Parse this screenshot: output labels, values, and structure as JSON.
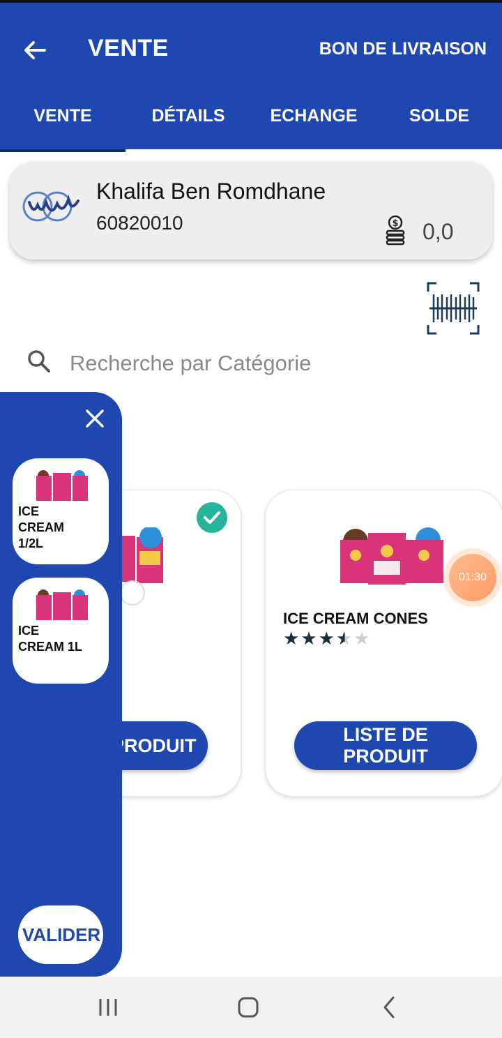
{
  "header": {
    "title": "VENTE",
    "action_label": "BON DE LIVRAISON",
    "tabs": [
      "VENTE",
      "DÉTAILS",
      "ECHANGE",
      "SOLDE"
    ],
    "active_tab": 0,
    "color": "#1f47b0"
  },
  "client": {
    "name": "Khalifa Ben Romdhane",
    "phone": "60820010",
    "balance": "0,0",
    "logo_icon": "company-logo",
    "balance_icon": "coins-dollar-icon"
  },
  "search": {
    "placeholder": "Recherche par Catégorie"
  },
  "products": [
    {
      "button_label": "PRODUIT",
      "selected": true
    },
    {
      "name": "ICE CREAM CONES",
      "rating": 3.5,
      "rating_max": 5,
      "button_label": "LISTE DE PRODUIT",
      "timer": "01:30"
    }
  ],
  "drawer": {
    "categories": [
      {
        "label": "ICE CREAM 1/2L"
      },
      {
        "label": "ICE CREAM 1L"
      }
    ],
    "validate_label": "VALIDER"
  }
}
